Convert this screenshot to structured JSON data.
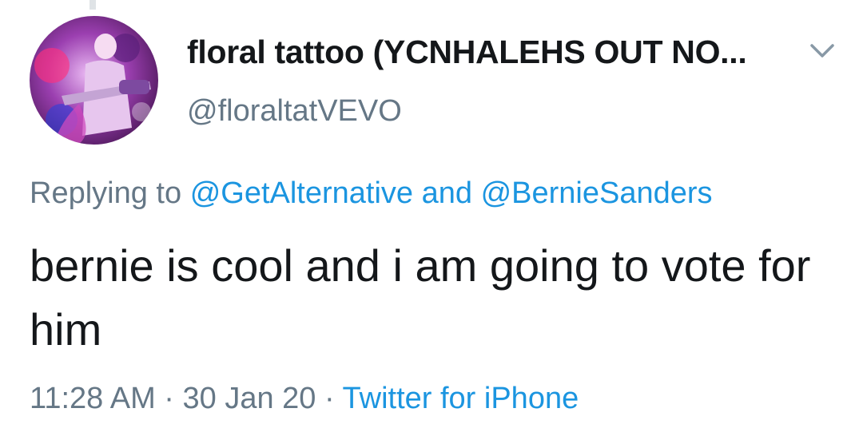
{
  "tweet": {
    "display_name": "floral tattoo (YCNHALEHS OUT NO...",
    "handle": "@floraltatVEVO",
    "reply": {
      "prefix": "Replying to",
      "mention_1": "@GetAlternative",
      "conjunction": "and",
      "mention_2": "@BernieSanders"
    },
    "text": "bernie is cool and i am going to vote for him",
    "time": "11:28 AM",
    "separator": "·",
    "date": "30 Jan 20",
    "source": "Twitter for iPhone"
  },
  "icons": {
    "menu": "chevron-down-icon",
    "avatar": "avatar-image"
  },
  "colors": {
    "text": "#14171a",
    "secondary": "#657786",
    "link": "#1b95e0",
    "thread_line": "#dfe3e6"
  }
}
